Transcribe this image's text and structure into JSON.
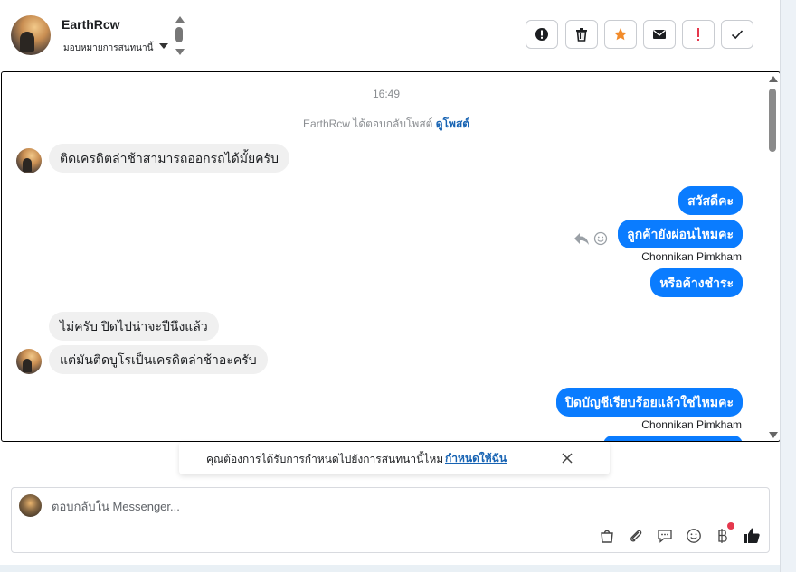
{
  "header": {
    "contact_name": "EarthRcw",
    "assign_label": "มอบหมายการสนทนานี้",
    "toolbar": [
      {
        "name": "report-spam-button",
        "icon": "alert-circle-icon",
        "color": "#1c1e21"
      },
      {
        "name": "delete-button",
        "icon": "trash-icon",
        "color": "#1c1e21"
      },
      {
        "name": "star-button",
        "icon": "star-icon",
        "color": "#f28b2a"
      },
      {
        "name": "mark-unread-button",
        "icon": "envelope-icon",
        "color": "#1c1e21"
      },
      {
        "name": "follow-up-button",
        "icon": "exclamation-icon",
        "color": "#e5384d"
      },
      {
        "name": "mark-done-button",
        "icon": "check-icon",
        "color": "#1c1e21"
      }
    ]
  },
  "conversation": {
    "timestamp": "16:49",
    "reply_note": "EarthRcw ได้ตอบกลับโพสต์",
    "reply_note_link": "ดูโพสต์",
    "messages": [
      {
        "dir": "in",
        "text": "ติดเครดิตล่าช้าสามารถออกรถได้มั้ยครับ"
      },
      {
        "dir": "out",
        "text": "สวัสดีคะ"
      },
      {
        "dir": "out",
        "text": "ลูกค้ายังผ่อนไหมคะ"
      },
      {
        "dir": "sender",
        "text": "Chonnikan Pimkham"
      },
      {
        "dir": "out",
        "text": "หรือค้างชำระ"
      },
      {
        "dir": "in",
        "text": "ไม่ครับ ปิดไปน่าจะปีนึงแล้ว"
      },
      {
        "dir": "in",
        "text": "แต่มันติดบูโรเป็นเครดิตล่าช้าอะครับ"
      },
      {
        "dir": "out",
        "text": "ปิดบัญชีเรียบร้อยแล้วใช่ไหมคะ"
      },
      {
        "dir": "sender",
        "text": "Chonnikan Pimkham"
      }
    ]
  },
  "reminder": {
    "text": "คุณต้องการได้รับการกำหนดไปยังการสนทนานี้ไหม",
    "link": "กำหนดให้ฉัน"
  },
  "composer": {
    "placeholder": "ตอบกลับใน Messenger...",
    "icons": [
      "shopping-bag-icon",
      "attachment-icon",
      "saved-reply-icon",
      "emoji-icon",
      "baht-icon",
      "thumbs-up-icon"
    ]
  },
  "colors": {
    "outgoing_bubble": "#0a7cff",
    "incoming_bubble": "#f0f0f0",
    "link": "#1763b3",
    "star": "#f28b2a",
    "alert_red": "#e5384d"
  }
}
